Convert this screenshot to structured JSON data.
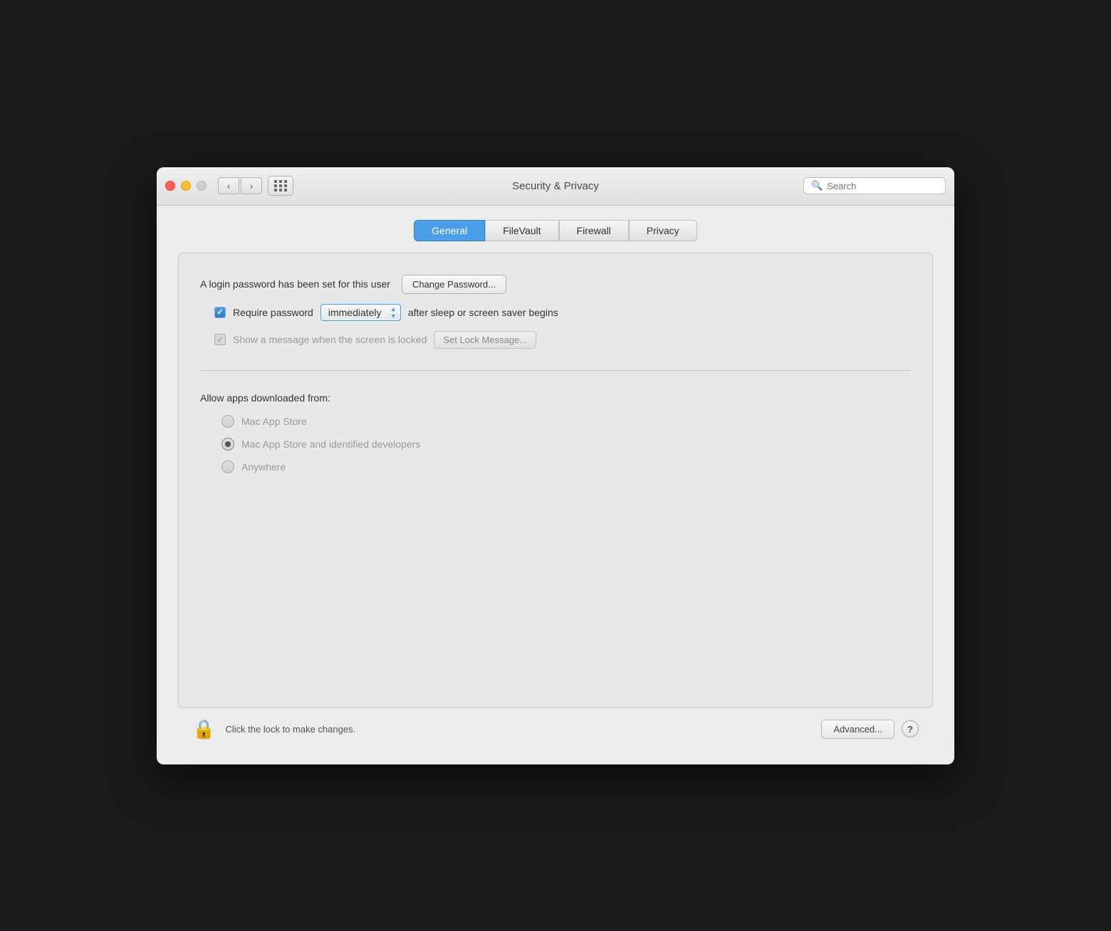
{
  "window": {
    "title": "Security & Privacy"
  },
  "titlebar": {
    "traffic_lights": {
      "close": "close",
      "minimize": "minimize",
      "maximize": "maximize"
    },
    "nav_back": "‹",
    "nav_forward": "›"
  },
  "search": {
    "placeholder": "Search"
  },
  "tabs": [
    {
      "id": "general",
      "label": "General",
      "active": true
    },
    {
      "id": "filevault",
      "label": "FileVault",
      "active": false
    },
    {
      "id": "firewall",
      "label": "Firewall",
      "active": false
    },
    {
      "id": "privacy",
      "label": "Privacy",
      "active": false
    }
  ],
  "general": {
    "password_set_label": "A login password has been set for this user",
    "change_password_btn": "Change Password...",
    "require_password_label": "Require password",
    "immediately_value": "immediately",
    "after_sleep_label": "after sleep or screen saver begins",
    "show_message_label": "Show a message when the screen is locked",
    "set_lock_message_btn": "Set Lock Message...",
    "allow_apps_label": "Allow apps downloaded from:",
    "radio_options": [
      {
        "id": "mac-app-store",
        "label": "Mac App Store",
        "selected": false
      },
      {
        "id": "mac-app-store-identified",
        "label": "Mac App Store and identified developers",
        "selected": true
      },
      {
        "id": "anywhere",
        "label": "Anywhere",
        "selected": false
      }
    ]
  },
  "bottom": {
    "lock_text": "Click the lock to make changes.",
    "advanced_btn": "Advanced...",
    "help_label": "?"
  }
}
